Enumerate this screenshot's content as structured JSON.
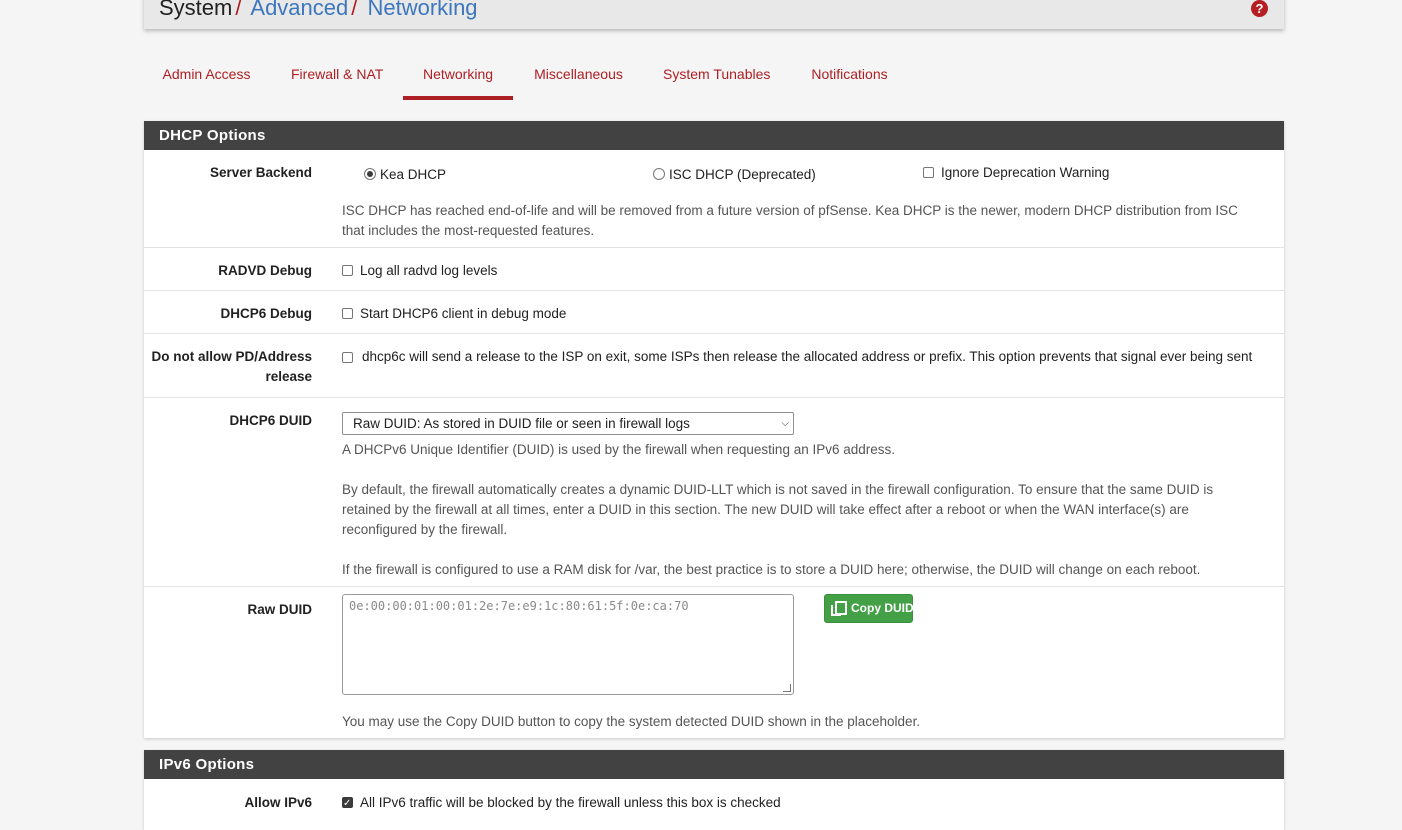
{
  "breadcrumb": {
    "root": "System",
    "items": [
      "Advanced",
      "Networking"
    ],
    "separator": "/"
  },
  "help_icon": "question-circle-icon",
  "tabs": [
    {
      "label": "Admin Access",
      "active": false
    },
    {
      "label": "Firewall & NAT",
      "active": false
    },
    {
      "label": "Networking",
      "active": true
    },
    {
      "label": "Miscellaneous",
      "active": false
    },
    {
      "label": "System Tunables",
      "active": false
    },
    {
      "label": "Notifications",
      "active": false
    }
  ],
  "dhcp": {
    "heading": "DHCP Options",
    "server_backend": {
      "label": "Server Backend",
      "kea_label": "Kea DHCP",
      "isc_label": "ISC DHCP (Deprecated)",
      "ignore_label": "Ignore Deprecation Warning",
      "help": "ISC DHCP has reached end-of-life and will be removed from a future version of pfSense. Kea DHCP is the newer, modern DHCP distribution from ISC that includes the most-requested features."
    },
    "radvd": {
      "label": "RADVD Debug",
      "text": "Log all radvd log levels"
    },
    "dhcp6_debug": {
      "label": "DHCP6 Debug",
      "text": "Start DHCP6 client in debug mode"
    },
    "no_release": {
      "label": "Do not allow PD/Address release",
      "text": "dhcp6c will send a release to the ISP on exit, some ISPs then release the allocated address or prefix. This option prevents that signal ever being sent"
    },
    "duid": {
      "label": "DHCP6 DUID",
      "selected": "Raw DUID: As stored in DUID file or seen in firewall logs",
      "help1": "A DHCPv6 Unique Identifier (DUID) is used by the firewall when requesting an IPv6 address.",
      "help2": "By default, the firewall automatically creates a dynamic DUID-LLT which is not saved in the firewall configuration. To ensure that the same DUID is retained by the firewall at all times, enter a DUID in this section. The new DUID will take effect after a reboot or when the WAN interface(s) are reconfigured by the firewall.",
      "help3": "If the firewall is configured to use a RAM disk for /var, the best practice is to store a DUID here; otherwise, the DUID will change on each reboot."
    },
    "raw_duid": {
      "label": "Raw DUID",
      "placeholder": "0e:00:00:01:00:01:2e:7e:e9:1c:80:61:5f:0e:ca:70",
      "button": "Copy DUID",
      "help": "You may use the Copy DUID button to copy the system detected DUID shown in the placeholder."
    }
  },
  "ipv6": {
    "heading": "IPv6 Options",
    "allow": {
      "label": "Allow IPv6",
      "text": "All IPv6 traffic will be blocked by the firewall unless this box is checked"
    }
  },
  "colors": {
    "accent": "#ad1f24",
    "link": "#3c77be",
    "panel_heading": "#424242",
    "success": "#43a047"
  }
}
